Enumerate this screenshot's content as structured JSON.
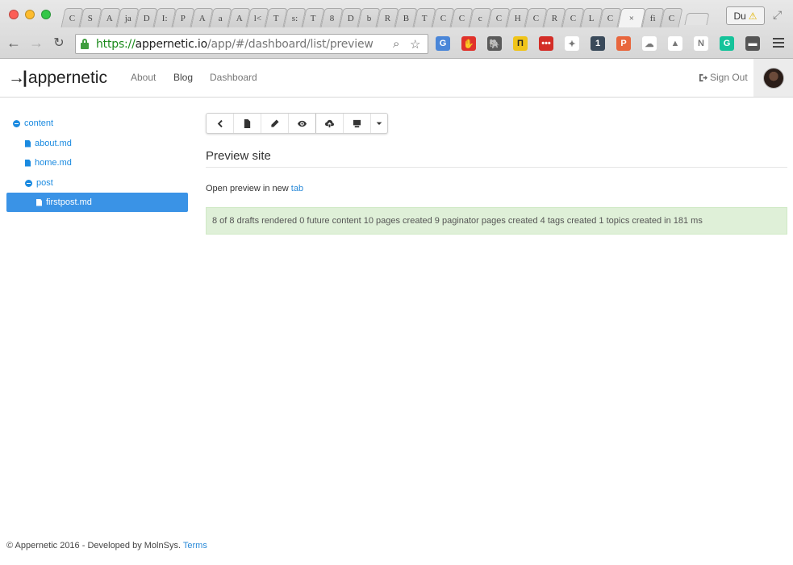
{
  "browser": {
    "tabs": [
      "C",
      "S",
      "A",
      "ja",
      "D",
      "I:",
      "P",
      "A",
      "a",
      "A",
      "l<",
      "T",
      "s:",
      "T",
      "8",
      "D",
      "b",
      "R",
      "B",
      "T",
      "C",
      "C",
      "c",
      "C",
      "H",
      "C",
      "R",
      "C",
      "L",
      "C",
      "×",
      "fi",
      "C"
    ],
    "profile_label": "Du",
    "url_scheme": "https://",
    "url_host": "appernetic.io",
    "url_path": "/app/#/dashboard/list/preview",
    "extensions": [
      {
        "name": "translate-extension-icon",
        "color": "#4a86d8",
        "text": "G"
      },
      {
        "name": "adblock-extension-icon",
        "color": "#e0322b",
        "text": "✋"
      },
      {
        "name": "evernote-extension-icon",
        "color": "#5a5a5a",
        "text": "🐘"
      },
      {
        "name": "pocket-extension-icon",
        "color": "#f0c419",
        "text": "П"
      },
      {
        "name": "lastpass-extension-icon",
        "color": "#d32d27",
        "text": "•••"
      },
      {
        "name": "pinwheel-extension-icon",
        "color": "#ffffff",
        "text": "✦"
      },
      {
        "name": "onepassword-extension-icon",
        "color": "#3a4a5a",
        "text": "1"
      },
      {
        "name": "producthunt-extension-icon",
        "color": "#e8663d",
        "text": "P"
      },
      {
        "name": "cloud-extension-icon",
        "color": "#ffffff",
        "text": "☁"
      },
      {
        "name": "drive-extension-icon",
        "color": "#ffffff",
        "text": "▲"
      },
      {
        "name": "notion-extension-icon",
        "color": "#ffffff",
        "text": "N"
      },
      {
        "name": "grammarly-extension-icon",
        "color": "#15c39a",
        "text": "G"
      },
      {
        "name": "inbox-extension-icon",
        "color": "#555555",
        "text": "▬"
      }
    ]
  },
  "app": {
    "brand": "appernetic",
    "nav": {
      "about": "About",
      "blog": "Blog",
      "dashboard": "Dashboard"
    },
    "signout": "Sign Out"
  },
  "tree": {
    "content": "content",
    "about": "about.md",
    "home": "home.md",
    "post": "post",
    "firstpost": "firstpost.md"
  },
  "main": {
    "heading": "Preview site",
    "preview_prefix": "Open preview in new",
    "preview_link": "tab",
    "alert": "8 of 8 drafts rendered 0 future content 10 pages created 9 paginator pages created 4 tags created 1 topics created in 181 ms"
  },
  "footer": {
    "text": "© Appernetic 2016 - Developed by MolnSys.",
    "terms": "Terms"
  }
}
